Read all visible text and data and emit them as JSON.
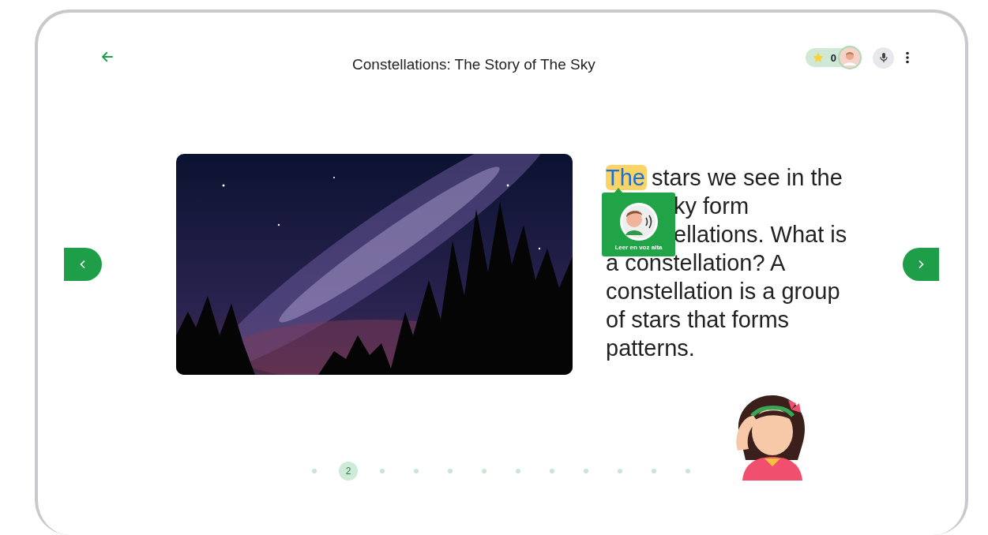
{
  "header": {
    "title": "Constellations: The Story of The Sky",
    "points": "0"
  },
  "passage": {
    "highlighted_word": "The",
    "lines": [
      {
        "text": "stars we see in the",
        "covered": false
      },
      {
        "text": "ky form",
        "covered": true
      },
      {
        "text": "ellations. What is",
        "covered": true
      },
      {
        "text": "a constellation? A",
        "covered": false
      },
      {
        "text": "constellation is a group",
        "covered": false
      },
      {
        "text": "of stars that forms",
        "covered": false
      },
      {
        "text": "patterns.",
        "covered": false
      }
    ]
  },
  "read_aloud": {
    "label": "Leer en voz alta"
  },
  "pager": {
    "pages": [
      {
        "selected": false
      },
      {
        "label": "2",
        "selected": true
      },
      {
        "selected": false
      },
      {
        "selected": false
      },
      {
        "selected": false
      },
      {
        "selected": false
      },
      {
        "selected": false
      },
      {
        "selected": false
      },
      {
        "selected": false
      },
      {
        "selected": false
      },
      {
        "selected": false
      },
      {
        "selected": false
      }
    ]
  }
}
